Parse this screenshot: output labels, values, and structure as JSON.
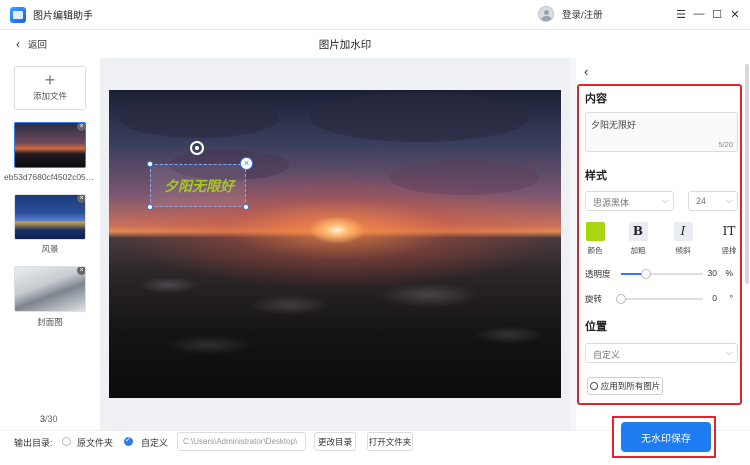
{
  "app": {
    "title": "图片编辑助手",
    "login": "登录/注册",
    "window_controls": [
      "☰",
      "—",
      "☐",
      "✕"
    ]
  },
  "header": {
    "back_label": "返回",
    "page_title": "图片加水印"
  },
  "left_panel": {
    "add_file_label": "添加文件",
    "files": [
      {
        "label": "eb53d7680cf4502c05a...",
        "selected": true
      },
      {
        "label": "风景",
        "selected": false
      },
      {
        "label": "封面图",
        "selected": false
      }
    ],
    "counter_current": "3",
    "counter_total": "/30"
  },
  "canvas": {
    "watermark_text": "夕阳无限好"
  },
  "settings": {
    "content_title": "内容",
    "content_value": "夕阳无限好",
    "content_count": "5/20",
    "style_title": "样式",
    "font_family": "思源黑体",
    "font_size": "24",
    "format_buttons": [
      {
        "label": "颜色",
        "icon": "color-swatch",
        "color": "#a8d60f"
      },
      {
        "label": "加粗",
        "icon": "B"
      },
      {
        "label": "倾斜",
        "icon": "I"
      },
      {
        "label": "竖排",
        "icon": "IT"
      }
    ],
    "opacity_label": "透明度",
    "opacity_value": "30",
    "opacity_unit": "%",
    "opacity_fraction": 0.3,
    "rotate_label": "旋转",
    "rotate_value": "0",
    "rotate_unit": "°",
    "position_title": "位置",
    "position_value": "自定义",
    "apply_all_label": "应用到所有图片"
  },
  "bottom": {
    "output_label": "输出目录:",
    "option_original": "原文件夹",
    "option_custom": "自定义",
    "path_value": "C:\\Users\\Administrator\\Desktop\\",
    "change_dir_label": "更改目录",
    "open_folder_label": "打开文件夹",
    "save_label": "无水印保存"
  },
  "colors": {
    "accent": "#1e7cf2",
    "highlight_frame": "#e0262c",
    "watermark": "#a8d60f"
  }
}
